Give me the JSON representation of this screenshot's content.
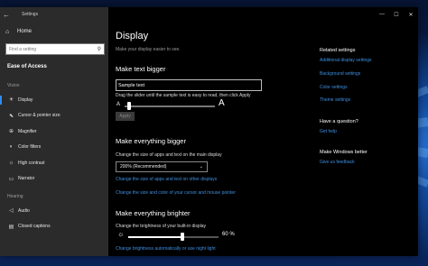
{
  "window": {
    "title": "Settings",
    "back_icon": "back-arrow-icon",
    "controls": [
      "—",
      "☐",
      "✕"
    ]
  },
  "sidebar": {
    "home_label": "Home",
    "search_placeholder": "Find a setting",
    "section_title": "Ease of Access",
    "groups": [
      {
        "label": "Vision",
        "items": [
          {
            "label": "Display",
            "icon": "display-icon",
            "active": true
          },
          {
            "label": "Cursor & pointer size",
            "icon": "cursor-icon"
          },
          {
            "label": "Magnifier",
            "icon": "magnifier-icon"
          },
          {
            "label": "Color filters",
            "icon": "color-filter-icon"
          },
          {
            "label": "High contrast",
            "icon": "contrast-icon"
          },
          {
            "label": "Narrator",
            "icon": "narrator-icon"
          }
        ]
      },
      {
        "label": "Hearing",
        "items": [
          {
            "label": "Audio",
            "icon": "speaker-icon"
          },
          {
            "label": "Closed captions",
            "icon": "captions-icon"
          }
        ]
      }
    ]
  },
  "main": {
    "title": "Display",
    "subtitle": "Make your display easier to see.",
    "text_bigger": {
      "heading": "Make text bigger",
      "sample_text": "Sample text",
      "instruction": "Drag the slider until the sample text is easy to read, then click Apply",
      "small_a": "A",
      "big_a": "A",
      "slider_value": 0.05,
      "apply_label": "Apply"
    },
    "everything_bigger": {
      "heading": "Make everything bigger",
      "instruction": "Change the size of apps and text on the main display",
      "dropdown_value": "200% (Recommended)",
      "link1": "Change the size of apps and text on other displays",
      "link2": "Change the size and color of your cursor and mouse pointer"
    },
    "everything_brighter": {
      "heading": "Make everything brighter",
      "instruction": "Change the brightness of your built-in display",
      "brightness_value": "60 %",
      "brightness_fraction": 0.6,
      "link": "Change brightness automatically or use night light"
    }
  },
  "related": {
    "heading": "Related settings",
    "links": [
      "Additional display settings",
      "Background settings",
      "Color settings",
      "Theme settings"
    ],
    "question_heading": "Have a question?",
    "question_link": "Get help",
    "better_heading": "Make Windows better",
    "better_link": "Give us feedback"
  },
  "colors": {
    "accent": "#2d8cf0",
    "link": "#3d8fe0",
    "sidebar_bg": "#2b2b2b",
    "main_bg": "#000000"
  }
}
